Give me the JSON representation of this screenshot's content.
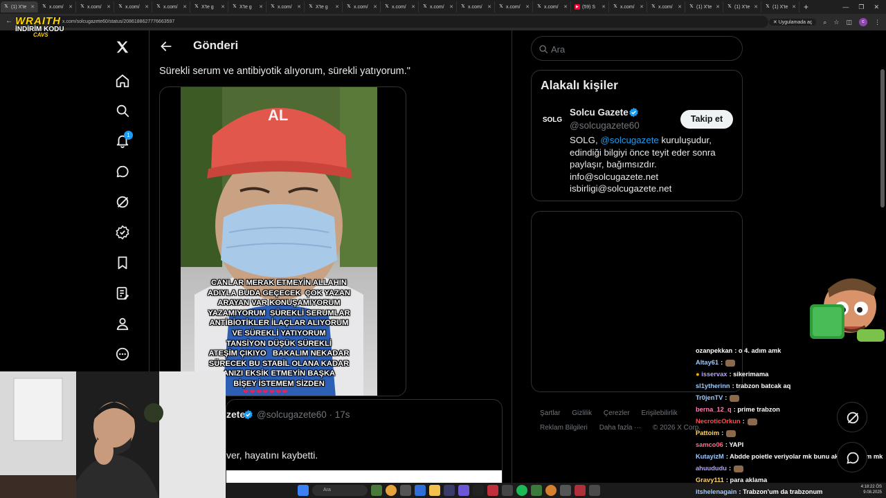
{
  "browser": {
    "tabs": [
      {
        "label": "(1) X'te",
        "icon": "x-icon",
        "active": true
      },
      {
        "label": "x.com/",
        "icon": "x-icon"
      },
      {
        "label": "x.com/",
        "icon": "x-icon"
      },
      {
        "label": "x.com/",
        "icon": "x-icon"
      },
      {
        "label": "x.com/",
        "icon": "x-icon"
      },
      {
        "label": "X'te g",
        "icon": "x-icon"
      },
      {
        "label": "X'te g",
        "icon": "x-icon"
      },
      {
        "label": "x.com/",
        "icon": "x-icon"
      },
      {
        "label": "X'te g",
        "icon": "x-icon"
      },
      {
        "label": "x.com/",
        "icon": "x-icon"
      },
      {
        "label": "x.com/",
        "icon": "x-icon"
      },
      {
        "label": "x.com/",
        "icon": "x-icon"
      },
      {
        "label": "x.com/",
        "icon": "x-icon"
      },
      {
        "label": "x.com/",
        "icon": "x-icon"
      },
      {
        "label": "x.com/",
        "icon": "x-icon"
      },
      {
        "label": "(59) S",
        "icon": "youtube-icon"
      },
      {
        "label": "x.com/",
        "icon": "x-icon"
      },
      {
        "label": "x.com/",
        "icon": "x-icon"
      },
      {
        "label": "(1) X'te",
        "icon": "x-icon"
      },
      {
        "label": "(1) X'te",
        "icon": "x-icon"
      },
      {
        "label": "(1) X'te",
        "icon": "x-icon"
      }
    ],
    "url": "x.com/solcugazete60/status/2086188627776663597",
    "apps_label": "Uygulamada aç"
  },
  "overlay_logo": {
    "line1": "WRAITH",
    "line2": "İNDİRİM KODU",
    "line3": "CAVS"
  },
  "nav": {
    "notification_count": "1"
  },
  "header": {
    "title": "Gönderi"
  },
  "post": {
    "text": "Sürekli serum ve antibiyotik alıyorum, sürekli yatıyorum.\"",
    "image_caption_lines": [
      "CANLAR MERAK ETMEYİN ALLAHIN",
      "ADIYLA BUDA GEÇECEK  ÇOK YAZAN",
      "ARAYAN VAR KONUŞAMIYORUM",
      "YAZAMIYORUM  SÜREKLİ SERUMLAR",
      "ANTİBİOTİKLER İLAÇLAR ALIYORUM",
      "VE SÜREKLİ YATIYORUM",
      "TANSİYON DÜŞÜK SÜREKLİ",
      "ATEŞİM ÇIKIYO   BAKALIM NEKADAR",
      "SÜRECEK BU STABİL OLANA KADAR",
      "ANIZI EKSİK ETMEYİN BAŞKA",
      "BİŞEY İSTEMEM SİZDEN"
    ],
    "cap_text": "AL"
  },
  "quoted": {
    "name_fragment": "zete",
    "handle": "@solcugazete60",
    "time": "· 17s",
    "text_fragment": "ver, hayatını kaybetti."
  },
  "sidebar": {
    "search_placeholder": "Ara",
    "related_title": "Alakalı kişiler",
    "person": {
      "avatar_text": "SOLG",
      "name": "Solcu Gazete",
      "handle": "@solcugazete60",
      "follow_label": "Takip et",
      "bio_prefix": "SOLG, ",
      "bio_mention": "@solcugazete",
      "bio_suffix": " kuruluşudur,",
      "bio_lines": [
        "edindiği bilgiyi önce teyit eder sonra",
        "paylaşır, bağımsızdır.",
        "info@solcugazete.net",
        "isbirligi@solcugazete.net"
      ]
    },
    "footer": [
      "Şartlar",
      "Gizlilik",
      "Çerezler",
      "Erişilebilirlik",
      "Reklam Bilgileri",
      "Daha fazla ···",
      "© 2026 X Corp."
    ]
  },
  "chat": [
    {
      "user": "ozanpekkan",
      "msg": ": o 4. adım amk",
      "color": "#ffffff"
    },
    {
      "user": "Altay61",
      "msg": ":",
      "color": "#9ecbff",
      "emote": true
    },
    {
      "user": "isservax",
      "msg": ": sikerimama",
      "color": "#b5a3ff",
      "badge": true
    },
    {
      "user": "sl1ytherinn",
      "msg": ": trabzon batcak aq",
      "color": "#9ecbff"
    },
    {
      "user": "Tr0jenTV",
      "msg": ":",
      "color": "#9ecbff",
      "emote": true
    },
    {
      "user": "berna_12_q",
      "msg": ": prime trabzon",
      "color": "#ff7eb3"
    },
    {
      "user": "NecroticOrkun",
      "msg": ":",
      "color": "#ff4d4d",
      "emote": true
    },
    {
      "user": "Pattoim",
      "msg": ":",
      "color": "#ffd66b",
      "emote": true
    },
    {
      "user": "samco06",
      "msg": ": YAPI",
      "color": "#ff6b8b"
    },
    {
      "user": "KutayizM",
      "msg": ": Abdde poietle veriyolar mk bunu akıl eden kim mk",
      "color": "#9ecbff"
    },
    {
      "user": "ahuududu",
      "msg": ":",
      "color": "#b5a3ff",
      "emote": true
    },
    {
      "user": "Gravy111",
      "msg": ": para aklama",
      "color": "#ffd66b"
    },
    {
      "user": "itshelenagain",
      "msg": ": Trabzon'um da trabzonum",
      "color": "#9ecbff"
    }
  ],
  "taskbar": {
    "search_label": "Ara",
    "time": "4:18:22 ÖS",
    "date": "9.08.2025"
  }
}
